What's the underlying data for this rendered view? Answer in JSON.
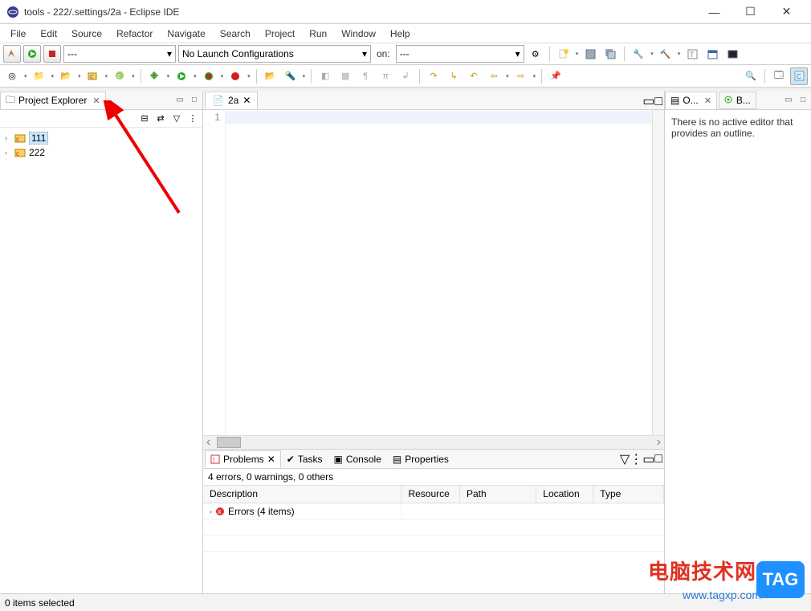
{
  "title": "tools - 222/.settings/2a - Eclipse IDE",
  "menu": [
    "File",
    "Edit",
    "Source",
    "Refactor",
    "Navigate",
    "Search",
    "Project",
    "Run",
    "Window",
    "Help"
  ],
  "launch": {
    "config_sel": "---",
    "config_placeholder": "No Launch Configurations",
    "on_label": "on:",
    "target_sel": "---"
  },
  "project_explorer": {
    "title": "Project Explorer",
    "items": [
      {
        "label": "111",
        "selected": true
      },
      {
        "label": "222",
        "selected": false
      }
    ]
  },
  "editor": {
    "tab_label": "2a",
    "line_number": "1"
  },
  "outline": {
    "tab1": "O...",
    "tab2": "B...",
    "message": "There is no active editor that provides an outline."
  },
  "problems": {
    "tabs": [
      "Problems",
      "Tasks",
      "Console",
      "Properties"
    ],
    "summary": "4 errors, 0 warnings, 0 others",
    "columns": [
      "Description",
      "Resource",
      "Path",
      "Location",
      "Type"
    ],
    "row0": "Errors (4 items)"
  },
  "statusbar": "0 items selected",
  "watermark": {
    "t1": "电脑技术网",
    "t2": "www.tagxp.com",
    "tag": "TAG"
  }
}
